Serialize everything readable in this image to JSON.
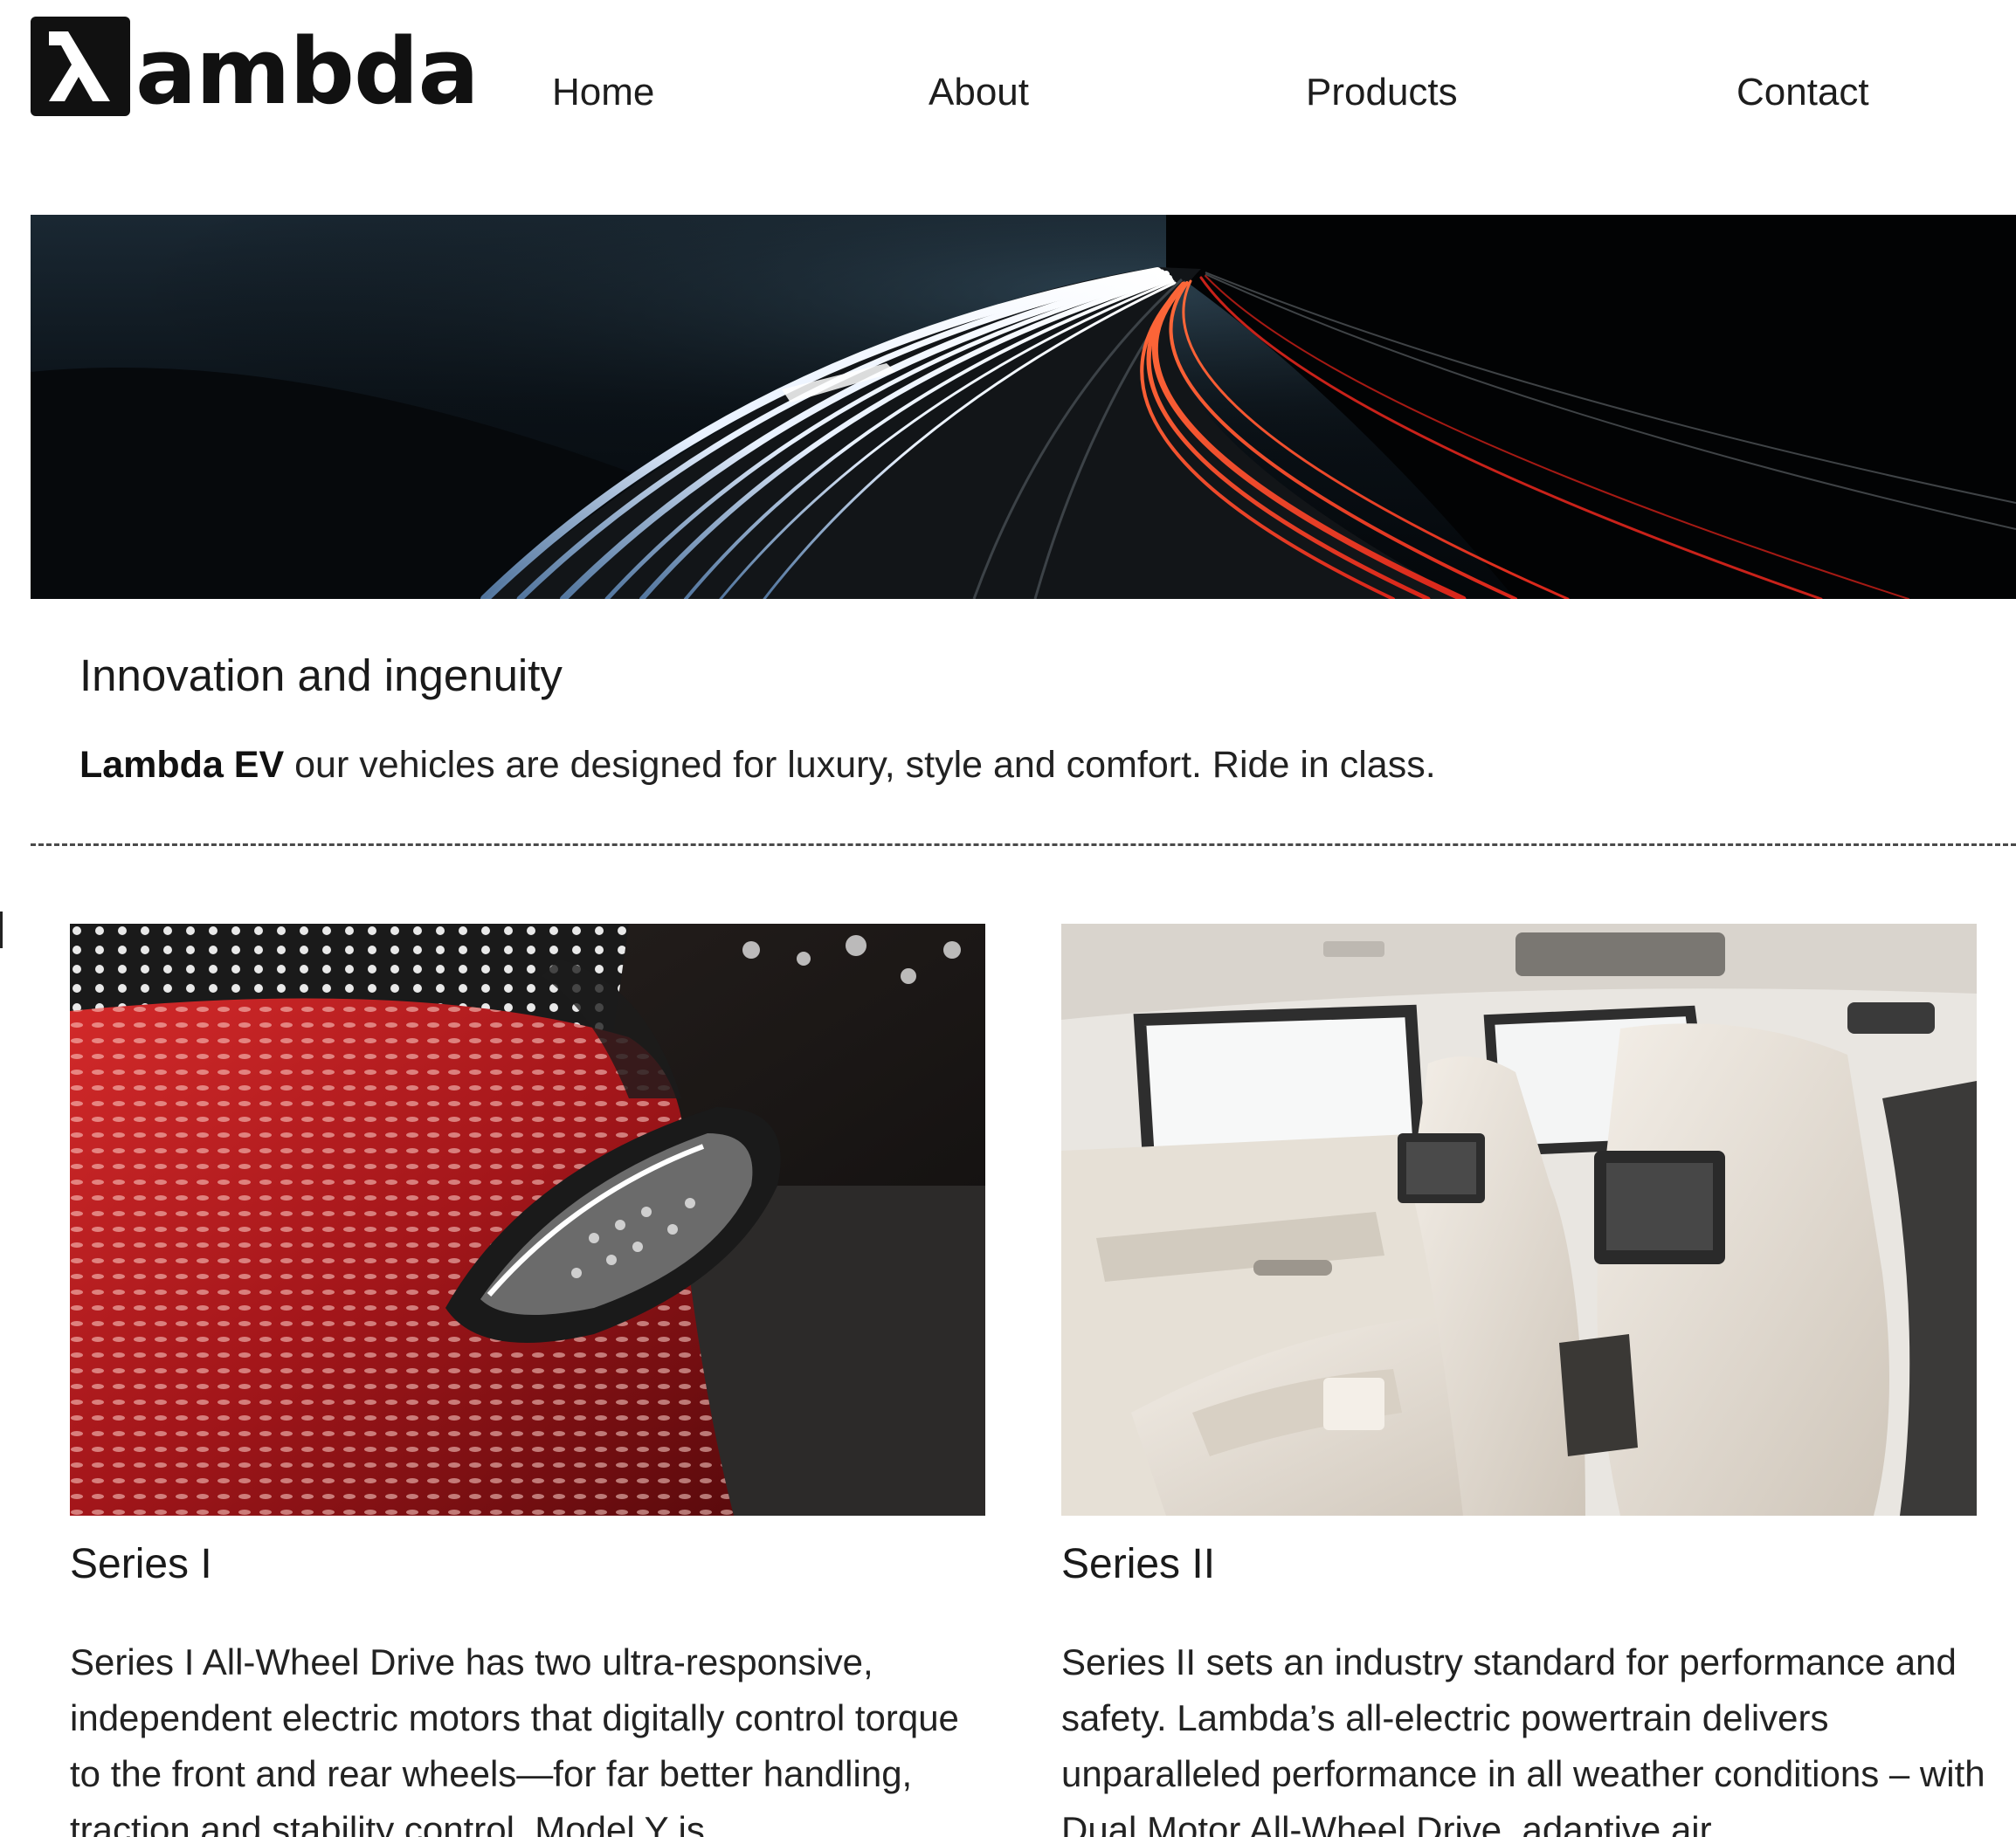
{
  "brand": {
    "logo_text": "ambda",
    "logo_symbol": "λ"
  },
  "nav": {
    "items": [
      {
        "label": "Home"
      },
      {
        "label": "About"
      },
      {
        "label": "Products"
      },
      {
        "label": "Contact"
      }
    ]
  },
  "hero": {
    "image": "highway-light-trails-night"
  },
  "intro": {
    "heading": "Innovation and ingenuity",
    "brand_strong": "Lambda EV",
    "text": " our vehicles are designed for luxury, style and comfort. Ride in class."
  },
  "products": [
    {
      "image": "red-electric-car-front-headlight",
      "title": "Series I",
      "description": "Series I All-Wheel Drive has two ultra-responsive, independent electric motors that digitally control torque to the front and rear wheels—for far better handling, traction and stability control. Model Y is"
    },
    {
      "image": "luxury-car-interior-rear-seats",
      "title": "Series II",
      "description": "Series II sets an industry standard for performance and safety. Lambda’s all-electric powertrain delivers unparalleled performance in all weather conditions – with Dual Motor All-Wheel Drive, adaptive air"
    }
  ],
  "colors": {
    "text": "#1d1d1d",
    "background": "#ffffff",
    "logo": "#111111",
    "divider": "#4a4a4a"
  }
}
